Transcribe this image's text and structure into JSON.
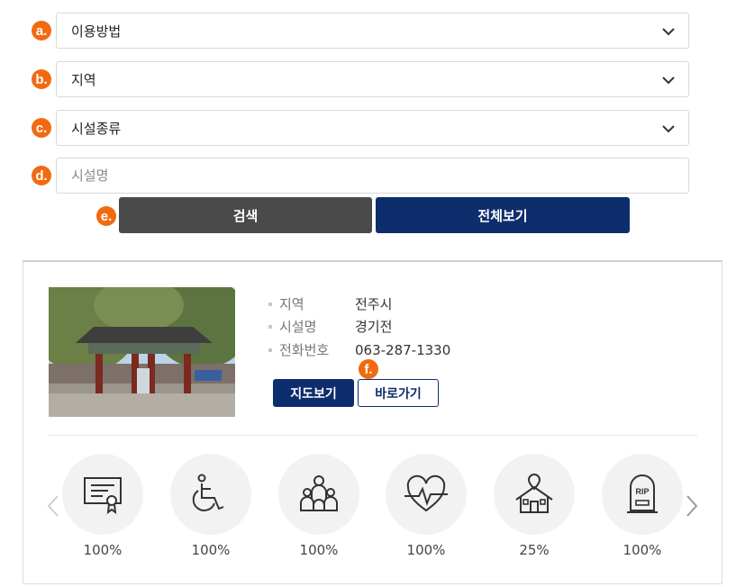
{
  "form": {
    "markers": {
      "a": "a.",
      "b": "b.",
      "c": "c.",
      "d": "d.",
      "e": "e.",
      "f": "f."
    },
    "usage_method": "이용방법",
    "region": "지역",
    "facility_type": "시설종류",
    "facility_name_placeholder": "시설명",
    "search_label": "검색",
    "view_all_label": "전체보기"
  },
  "result": {
    "info": [
      {
        "label": "지역",
        "value": "전주시"
      },
      {
        "label": "시설명",
        "value": "경기전"
      },
      {
        "label": "전화번호",
        "value": "063-287-1330"
      }
    ],
    "map_button": "지도보기",
    "go_button": "바로가기",
    "amenities": [
      {
        "icon": "certificate-icon",
        "percent": "100%"
      },
      {
        "icon": "wheelchair-icon",
        "percent": "100%"
      },
      {
        "icon": "family-icon",
        "percent": "100%"
      },
      {
        "icon": "heartbeat-icon",
        "percent": "100%"
      },
      {
        "icon": "house-location-icon",
        "percent": "25%"
      },
      {
        "icon": "tombstone-icon",
        "percent": "100%"
      }
    ],
    "tombstone_text": "RIP"
  },
  "colors": {
    "accent_orange": "#f26a10",
    "navy": "#0e2d6d",
    "dark_gray": "#4a4a4a"
  }
}
